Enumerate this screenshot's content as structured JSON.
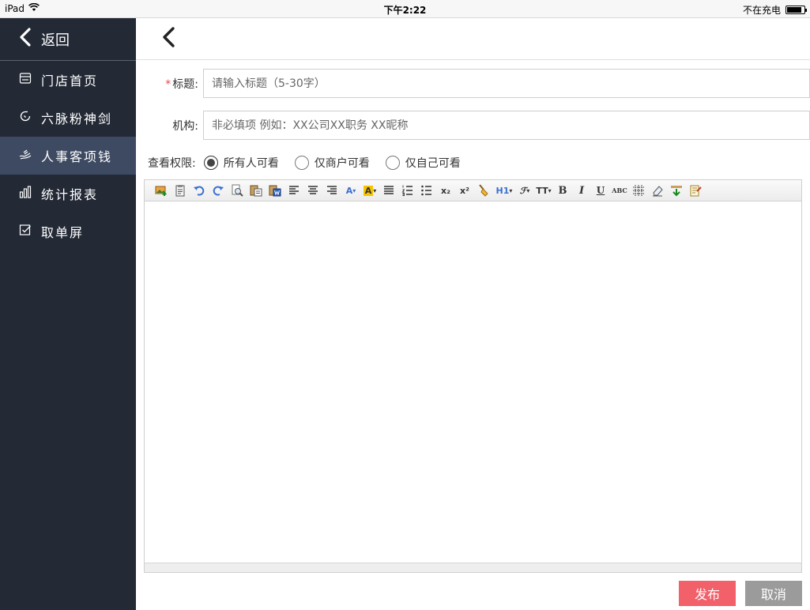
{
  "status_bar": {
    "device": "iPad",
    "time": "下午2:22",
    "charging": "不在充电",
    "battery_level": 0.85
  },
  "sidebar": {
    "back_label": "返回",
    "items": [
      {
        "label": "门店首页",
        "icon": "store-icon"
      },
      {
        "label": "六脉粉神剑",
        "icon": "refresh-icon"
      },
      {
        "label": "人事客项钱",
        "icon": "hand-icon",
        "active": true
      },
      {
        "label": "统计报表",
        "icon": "bar-chart-icon"
      },
      {
        "label": "取单屏",
        "icon": "checkbox-icon"
      }
    ]
  },
  "form": {
    "title_label": "标题:",
    "title_required": "*",
    "title_placeholder": "请输入标题（5-30字）",
    "org_label": "机构:",
    "org_placeholder": "非必填项 例如：XX公司XX职务 XX昵称",
    "permission_label": "查看权限:",
    "permission_options": [
      {
        "label": "所有人可看",
        "checked": true
      },
      {
        "label": "仅商户可看",
        "checked": false
      },
      {
        "label": "仅自己可看",
        "checked": false
      }
    ]
  },
  "editor_toolbar": {
    "heading_label": "H1",
    "font_size_label": "TT",
    "bold_label": "B",
    "italic_label": "I",
    "underline_label": "U",
    "strike_label": "ABC",
    "subscript_label": "x₂",
    "superscript_label": "x²",
    "font_color_label": "A",
    "bg_color_label": "A"
  },
  "actions": {
    "publish_label": "发布",
    "cancel_label": "取消"
  },
  "colors": {
    "sidebar_bg": "#232a36",
    "sidebar_active": "#3d4a62",
    "publish": "#f2606a",
    "cancel": "#9b9b9b",
    "required": "#e84a4a"
  }
}
